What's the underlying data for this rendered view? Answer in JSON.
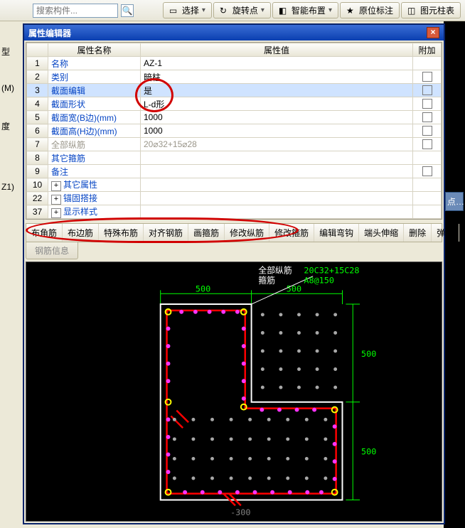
{
  "search": {
    "placeholder": "搜索构件..."
  },
  "top_toolbar": {
    "select": "选择",
    "rotate": "旋转点",
    "smart": "智能布置",
    "loc": "原位标注",
    "coltbl": "图元柱表"
  },
  "left_fringe": {
    "a": "型",
    "b": "(M)",
    "c": "度",
    "d": "Z1)"
  },
  "right_strip": {
    "pt": "点…"
  },
  "dialog": {
    "title": "属性编辑器"
  },
  "grid": {
    "col_name": "属性名称",
    "col_value": "属性值",
    "col_add": "附加",
    "rows": [
      {
        "n": "1",
        "name": "名称",
        "val": "AZ-1",
        "blue": true
      },
      {
        "n": "2",
        "name": "类别",
        "val": "暗柱",
        "blue": true,
        "chk": true
      },
      {
        "n": "3",
        "name": "截面编辑",
        "val": "是",
        "blue": true,
        "sel": true,
        "chk": true
      },
      {
        "n": "4",
        "name": "截面形状",
        "val": "L-d形",
        "blue": true,
        "chk": true
      },
      {
        "n": "5",
        "name": "截面宽(B边)(mm)",
        "val": "1000",
        "blue": true,
        "chk": true
      },
      {
        "n": "6",
        "name": "截面高(H边)(mm)",
        "val": "1000",
        "blue": true,
        "chk": true
      },
      {
        "n": "7",
        "name": "全部纵筋",
        "val": "20⌀32+15⌀28",
        "grey": true,
        "chk": true
      },
      {
        "n": "8",
        "name": "其它箍筋",
        "val": "",
        "blue": true
      },
      {
        "n": "9",
        "name": "备注",
        "val": "",
        "blue": true,
        "chk": true
      },
      {
        "n": "10",
        "name": "其它属性",
        "val": "",
        "blue": true,
        "exp": true
      },
      {
        "n": "22",
        "name": "锚固搭接",
        "val": "",
        "blue": true,
        "exp": true
      },
      {
        "n": "37",
        "name": "显示样式",
        "val": "",
        "blue": true,
        "exp": true
      }
    ]
  },
  "edit_row": [
    "布角筋",
    "布边筋",
    "特殊布筋",
    "对齐钢筋",
    "画箍筋",
    "修改纵筋",
    "修改箍筋",
    "编辑弯钩",
    "端头伸缩",
    "删除",
    "弹出"
  ],
  "sub_tab": "钢筋信息",
  "canvas": {
    "all_label": "全部纵筋",
    "all_val": "20C32+15C28",
    "hoop_label": "箍筋",
    "hoop_val": "A8@150",
    "d500_t1": "500",
    "d500_t2": "500",
    "d500_r1": "500",
    "d500_r2": "500",
    "d300_b": "-300"
  },
  "chart_data": {
    "type": "diagram",
    "shape": "L",
    "overall_width_mm": 1000,
    "overall_height_mm": 1000,
    "vertical_leg": {
      "width_mm": 500,
      "height_mm": 1000
    },
    "horizontal_leg": {
      "width_mm": 1000,
      "height_mm": 500
    },
    "longitudinal_bars": "20C32+15C28",
    "hoop": "A8@150"
  }
}
